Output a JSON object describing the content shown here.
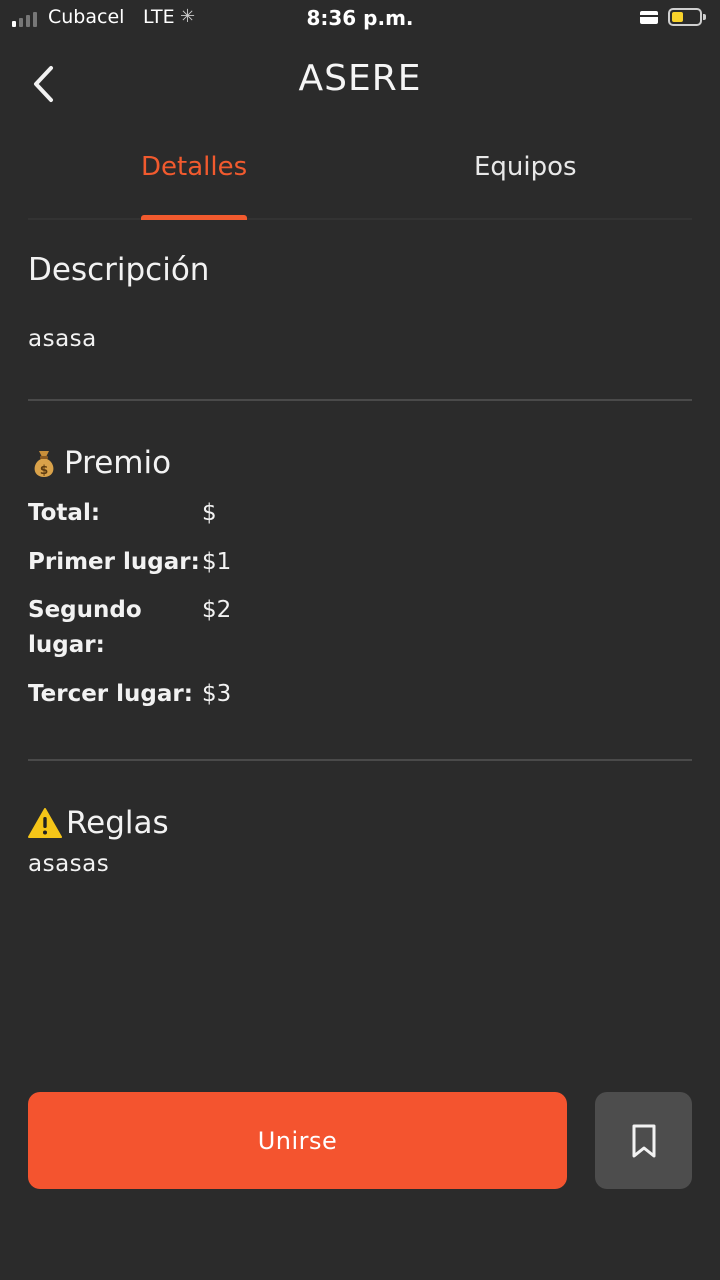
{
  "status_bar": {
    "carrier": "Cubacel",
    "network": "LTE",
    "time": "8:36 p.m.",
    "battery_color": "#f7d22b"
  },
  "header": {
    "back_icon": "chevron-left-icon",
    "title": "ASERE"
  },
  "tabs": [
    {
      "label": "Detalles",
      "active": true
    },
    {
      "label": "Equipos",
      "active": false
    }
  ],
  "description": {
    "heading": "Descripción",
    "text": "asasa"
  },
  "prize": {
    "icon": "money-bag-icon",
    "heading": "Premio",
    "rows": [
      {
        "label": "Total:",
        "value": "$"
      },
      {
        "label": "Primer lugar:",
        "value": "$1"
      },
      {
        "label": "Segundo lugar:",
        "value": "$2"
      },
      {
        "label": "Tercer lugar:",
        "value": "$3"
      }
    ]
  },
  "rules": {
    "icon": "warning-icon",
    "heading": "Reglas",
    "text": "asasas"
  },
  "actions": {
    "join_label": "Unirse",
    "bookmark_icon": "bookmark-icon",
    "accent_color": "#f4542f"
  }
}
